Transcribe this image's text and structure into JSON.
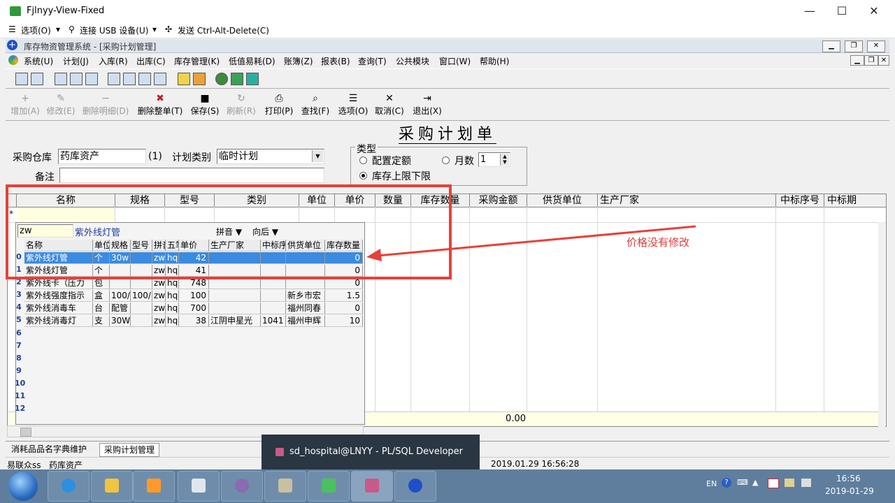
{
  "outer_window": {
    "title": "Fjlnyy-View-Fixed",
    "minimize": "—",
    "maximize": "☐",
    "close": "✕"
  },
  "outer_menu": [
    "选项(O)",
    "连接 USB 设备(U)",
    "发送 Ctrl-Alt-Delete(C)"
  ],
  "mdi_window": {
    "title": "库存物资管理系统 - [采购计划管理]"
  },
  "app_menu": [
    "系统(U)",
    "计划(J)",
    "入库(R)",
    "出库(C)",
    "库存管理(K)",
    "低值易耗(D)",
    "账簿(Z)",
    "报表(B)",
    "查询(T)",
    "公共模块",
    "窗口(W)",
    "帮助(H)"
  ],
  "toolbar": [
    {
      "label": "增加(A)",
      "glyph": "+",
      "enabled": false
    },
    {
      "label": "修改(E)",
      "glyph": "✎",
      "enabled": false
    },
    {
      "label": "删除明细(D)",
      "glyph": "−",
      "enabled": false
    },
    {
      "label": "删除整单(T)",
      "glyph": "✖",
      "enabled": true
    },
    {
      "label": "保存(S)",
      "glyph": "■",
      "enabled": true
    },
    {
      "label": "刷新(R)",
      "glyph": "↻",
      "enabled": false
    },
    {
      "label": "打印(P)",
      "glyph": "⎙",
      "enabled": true
    },
    {
      "label": "查找(F)",
      "glyph": "⌕",
      "enabled": true
    },
    {
      "label": "选项(O)",
      "glyph": "☰",
      "enabled": true
    },
    {
      "label": "取消(C)",
      "glyph": "✕",
      "enabled": true
    },
    {
      "label": "退出(X)",
      "glyph": "⇥",
      "enabled": true
    }
  ],
  "form": {
    "title": "采购计划单",
    "warehouse_label": "采购仓库",
    "warehouse_value": "药库资产",
    "warehouse_code": "(1)",
    "plan_type_label": "计划类别",
    "plan_type_value": "临时计划",
    "remark_label": "备注",
    "type_group_label": "类型",
    "radio_quota": "配置定额",
    "radio_months": "月数",
    "months_value": "1",
    "radio_stock_limits": "库存上限下限"
  },
  "grid": {
    "columns": [
      "名称",
      "规格",
      "型号",
      "类别",
      "单位",
      "单价",
      "数量",
      "库存数量",
      "采购金额",
      "供货单位",
      "生产厂家",
      "中标序号",
      "中标期"
    ],
    "row_marker": "*",
    "total_amount": "0.00"
  },
  "popup": {
    "search_value": "zw",
    "current_item": "紫外线灯管",
    "mode1": "拼音",
    "mode2": "向后",
    "columns": [
      "名称",
      "单位",
      "规格",
      "型号",
      "拼音",
      "五笔",
      "单价",
      "生产厂家",
      "中标序号",
      "供货单位",
      "库存数量"
    ],
    "rows": [
      {
        "no": "0",
        "name": "紫外线灯管",
        "unit": "个",
        "spec": "30w",
        "model": "",
        "py": "zw",
        "wb": "hq",
        "price": "42",
        "maker": "",
        "bid": "",
        "supplier": "",
        "stock": "0"
      },
      {
        "no": "1",
        "name": "紫外线灯管",
        "unit": "个",
        "spec": "",
        "model": "",
        "py": "zw",
        "wb": "hq",
        "price": "41",
        "maker": "",
        "bid": "",
        "supplier": "",
        "stock": "0"
      },
      {
        "no": "2",
        "name": "紫外线卡（压力",
        "unit": "包",
        "spec": "",
        "model": "",
        "py": "zw",
        "wb": "hq",
        "price": "748",
        "maker": "",
        "bid": "",
        "supplier": "",
        "stock": "0"
      },
      {
        "no": "3",
        "name": "紫外线强度指示",
        "unit": "盒",
        "spec": "100/",
        "model": "100/",
        "py": "zw",
        "wb": "hq",
        "price": "100",
        "maker": "",
        "bid": "",
        "supplier": "新乡市宏",
        "stock": "1.5"
      },
      {
        "no": "4",
        "name": "紫外线消毒车",
        "unit": "台",
        "spec": "配管",
        "model": "",
        "py": "zw",
        "wb": "hq",
        "price": "700",
        "maker": "",
        "bid": "",
        "supplier": "福州同春",
        "stock": "0"
      },
      {
        "no": "5",
        "name": "紫外线消毒灯",
        "unit": "支",
        "spec": "30W",
        "model": "",
        "py": "zw",
        "wb": "hq",
        "price": "38",
        "maker": "江阴申星光",
        "bid": "1041",
        "supplier": "福州申辉",
        "stock": "10"
      }
    ],
    "empty_row_numbers": [
      "6",
      "7",
      "8",
      "9",
      "10",
      "11",
      "12"
    ]
  },
  "annotation": {
    "text": "价格没有修改",
    "color": "#e23b36"
  },
  "status_tabs": [
    "消耗品品名字典维护",
    "采购计划管理"
  ],
  "status_bar": {
    "user": "易联众ss",
    "warehouse": "药库资产",
    "datetime": "2019.01.29 16:56:28"
  },
  "notification": {
    "text": "sd_hospital@LNYY - PL/SQL Developer"
  },
  "taskbar": {
    "lang": "EN",
    "time": "16:56",
    "date": "2019-01-29",
    "apps": [
      "start-orb",
      "ie",
      "explorer",
      "media",
      "app-doctor",
      "app-compass",
      "app-grampa",
      "app-recycle",
      "plsql-developer",
      "app-plus"
    ]
  }
}
